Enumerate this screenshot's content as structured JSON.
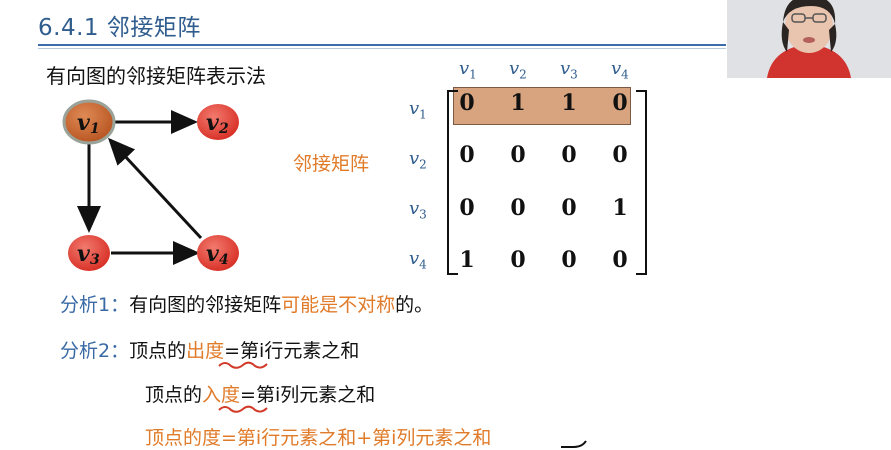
{
  "header": {
    "title": "6.4.1 邻接矩阵"
  },
  "subtitle": "有向图的邻接矩阵表示法",
  "graph": {
    "nodes": [
      {
        "id": "v1",
        "label": "v",
        "sub": "1"
      },
      {
        "id": "v2",
        "label": "v",
        "sub": "2"
      },
      {
        "id": "v3",
        "label": "v",
        "sub": "3"
      },
      {
        "id": "v4",
        "label": "v",
        "sub": "4"
      }
    ],
    "edges": [
      [
        "v1",
        "v2"
      ],
      [
        "v1",
        "v3"
      ],
      [
        "v3",
        "v4"
      ],
      [
        "v4",
        "v1"
      ]
    ],
    "colors": {
      "node": "#e8453c",
      "highlight_node": "#c8622d",
      "highlight_ring": "#9aa39a"
    }
  },
  "matrix": {
    "name": "邻接矩阵",
    "col_headers": [
      {
        "v": "v",
        "sub": "1"
      },
      {
        "v": "v",
        "sub": "2"
      },
      {
        "v": "v",
        "sub": "3"
      },
      {
        "v": "v",
        "sub": "4"
      }
    ],
    "row_headers": [
      {
        "v": "v",
        "sub": "1"
      },
      {
        "v": "v",
        "sub": "2"
      },
      {
        "v": "v",
        "sub": "3"
      },
      {
        "v": "v",
        "sub": "4"
      }
    ],
    "rows": [
      [
        "0",
        "1",
        "1",
        "0"
      ],
      [
        "0",
        "0",
        "0",
        "0"
      ],
      [
        "0",
        "0",
        "0",
        "1"
      ],
      [
        "1",
        "0",
        "0",
        "0"
      ]
    ],
    "highlight_color": "#d7a47f"
  },
  "analysis1": {
    "label": "分析1：",
    "text_a": "有向图的邻接矩阵",
    "text_b": "可能是不对称",
    "text_c": "的。"
  },
  "analysis2": {
    "label": "分析2：",
    "out_a": "顶点的",
    "out_b": "出度",
    "out_c": "=第i行元素之和",
    "in_a": "顶点的",
    "in_b": "入度",
    "in_c": "=第i列元素之和",
    "deg": "顶点的度=第i行元素之和+第i列元素之和"
  }
}
